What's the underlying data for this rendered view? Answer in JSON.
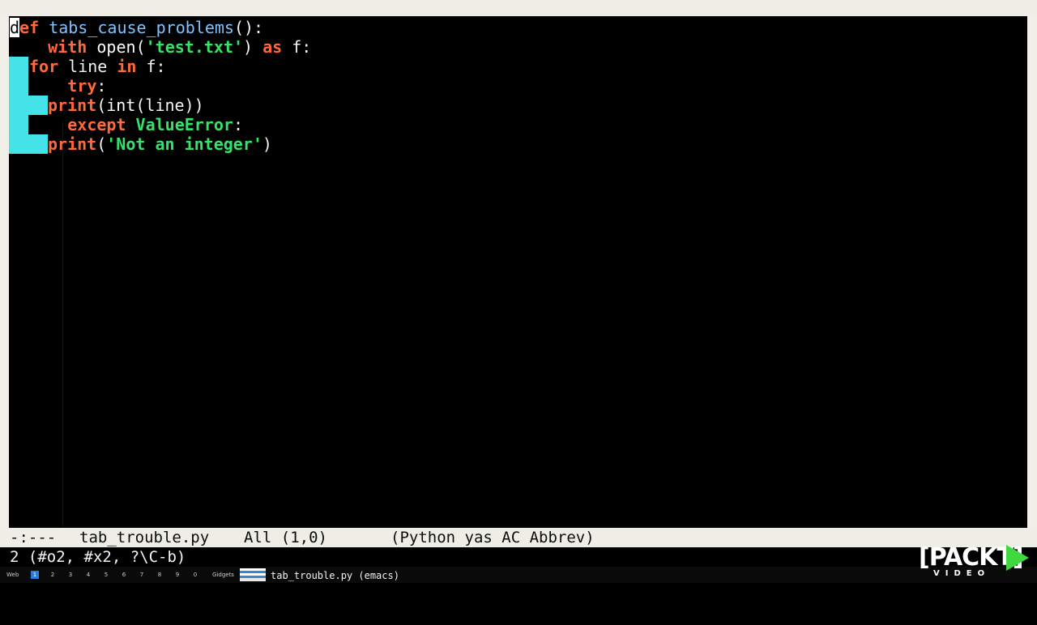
{
  "editor": {
    "lines": [
      {
        "tokens": [
          {
            "t": "d",
            "c": "cursor-char"
          },
          {
            "t": "ef",
            "c": "kw"
          },
          {
            "t": " ",
            "c": "txt"
          },
          {
            "t": "tabs_cause_problems",
            "c": "fn"
          },
          {
            "t": "():",
            "c": "txt"
          }
        ]
      },
      {
        "tokens": [
          {
            "t": "    ",
            "c": "txt"
          },
          {
            "t": "with",
            "c": "kw"
          },
          {
            "t": " ",
            "c": "txt"
          },
          {
            "t": "open",
            "c": "bi"
          },
          {
            "t": "(",
            "c": "txt"
          },
          {
            "t": "'test.txt'",
            "c": "str"
          },
          {
            "t": ") ",
            "c": "txt"
          },
          {
            "t": "as",
            "c": "kw"
          },
          {
            "t": " f:",
            "c": "txt"
          }
        ]
      },
      {
        "tokens": [
          {
            "t": "for",
            "c": "kw"
          },
          {
            "t": " line ",
            "c": "txt"
          },
          {
            "t": "in",
            "c": "kw"
          },
          {
            "t": " f:",
            "c": "txt"
          }
        ]
      },
      {
        "tokens": [
          {
            "t": "      ",
            "c": "txt"
          },
          {
            "t": "try",
            "c": "kw"
          },
          {
            "t": ":",
            "c": "txt"
          }
        ]
      },
      {
        "tokens": [
          {
            "t": "print",
            "c": "kw"
          },
          {
            "t": "(",
            "c": "txt"
          },
          {
            "t": "int",
            "c": "bi"
          },
          {
            "t": "(line))",
            "c": "txt"
          }
        ]
      },
      {
        "tokens": [
          {
            "t": "      ",
            "c": "txt"
          },
          {
            "t": "except",
            "c": "kw"
          },
          {
            "t": " ",
            "c": "txt"
          },
          {
            "t": "ValueError",
            "c": "cls"
          },
          {
            "t": ":",
            "c": "txt"
          }
        ]
      },
      {
        "tokens": [
          {
            "t": "print",
            "c": "kw"
          },
          {
            "t": "(",
            "c": "txt"
          },
          {
            "t": "'Not an integer'",
            "c": "str"
          },
          {
            "t": ")",
            "c": "txt"
          }
        ]
      }
    ]
  },
  "modeline": {
    "status": "-:---",
    "buffer_name": "tab_trouble.py",
    "position": "All (1,0)",
    "modes": "(Python yas AC Abbrev)"
  },
  "minibuffer": {
    "text": "2 (#o2, #x2, ?\\C-b)"
  },
  "taskbar": {
    "left_label": "Web",
    "workspaces": [
      "1",
      "2",
      "3",
      "4",
      "5",
      "6",
      "7",
      "8",
      "9",
      "0"
    ],
    "active_workspace": "1",
    "widgets_label": "Gidgets",
    "task_label": "tab_trouble.py (emacs)"
  },
  "logo": {
    "text": "[PACKT]",
    "sub": "VIDEO"
  },
  "colors": {
    "tab_highlight": "#44e3e9",
    "keyword": "#ff6a3d",
    "string": "#35e26a",
    "function": "#7fc4ff",
    "modeline_bg": "#efeee6"
  }
}
